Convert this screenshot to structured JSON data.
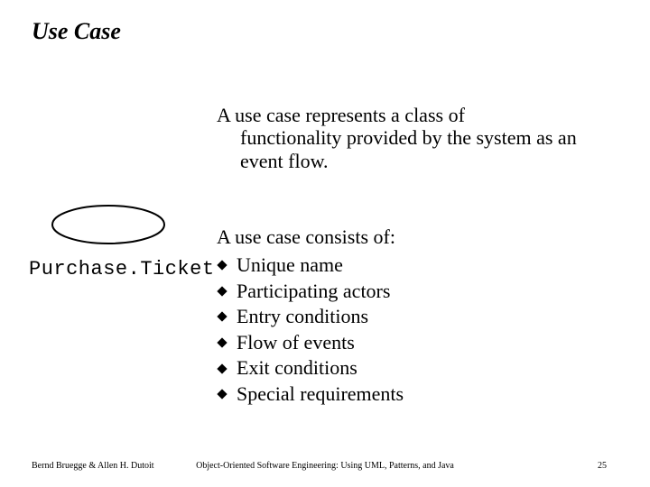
{
  "title": "Use Case",
  "intro_line1": "A use case represents a class of",
  "intro_line2": "functionality provided by the system as an",
  "intro_line3": "event flow.",
  "example_label": "Purchase.Ticket",
  "consists_heading": "A use case consists of:",
  "items": {
    "0": "Unique name",
    "1": "Participating actors",
    "2": "Entry conditions",
    "3": "Flow of events",
    "4": "Exit conditions",
    "5": "Special requirements"
  },
  "footer": {
    "left": "Bernd Bruegge & Allen H. Dutoit",
    "center": "Object-Oriented Software Engineering: Using UML, Patterns, and Java",
    "right": "25"
  }
}
